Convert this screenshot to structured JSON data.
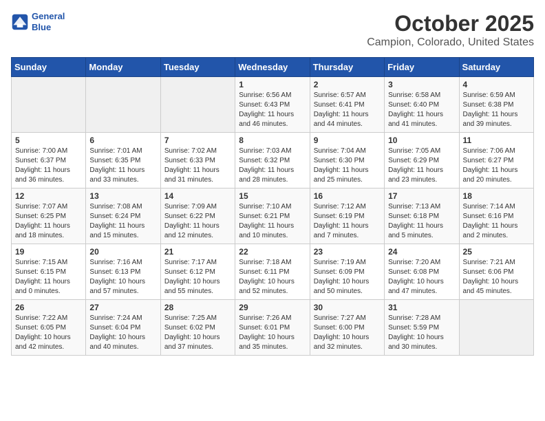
{
  "header": {
    "logo_line1": "General",
    "logo_line2": "Blue",
    "title": "October 2025",
    "subtitle": "Campion, Colorado, United States"
  },
  "days_of_week": [
    "Sunday",
    "Monday",
    "Tuesday",
    "Wednesday",
    "Thursday",
    "Friday",
    "Saturday"
  ],
  "weeks": [
    [
      {
        "day": "",
        "info": ""
      },
      {
        "day": "",
        "info": ""
      },
      {
        "day": "",
        "info": ""
      },
      {
        "day": "1",
        "info": "Sunrise: 6:56 AM\nSunset: 6:43 PM\nDaylight: 11 hours and 46 minutes."
      },
      {
        "day": "2",
        "info": "Sunrise: 6:57 AM\nSunset: 6:41 PM\nDaylight: 11 hours and 44 minutes."
      },
      {
        "day": "3",
        "info": "Sunrise: 6:58 AM\nSunset: 6:40 PM\nDaylight: 11 hours and 41 minutes."
      },
      {
        "day": "4",
        "info": "Sunrise: 6:59 AM\nSunset: 6:38 PM\nDaylight: 11 hours and 39 minutes."
      }
    ],
    [
      {
        "day": "5",
        "info": "Sunrise: 7:00 AM\nSunset: 6:37 PM\nDaylight: 11 hours and 36 minutes."
      },
      {
        "day": "6",
        "info": "Sunrise: 7:01 AM\nSunset: 6:35 PM\nDaylight: 11 hours and 33 minutes."
      },
      {
        "day": "7",
        "info": "Sunrise: 7:02 AM\nSunset: 6:33 PM\nDaylight: 11 hours and 31 minutes."
      },
      {
        "day": "8",
        "info": "Sunrise: 7:03 AM\nSunset: 6:32 PM\nDaylight: 11 hours and 28 minutes."
      },
      {
        "day": "9",
        "info": "Sunrise: 7:04 AM\nSunset: 6:30 PM\nDaylight: 11 hours and 25 minutes."
      },
      {
        "day": "10",
        "info": "Sunrise: 7:05 AM\nSunset: 6:29 PM\nDaylight: 11 hours and 23 minutes."
      },
      {
        "day": "11",
        "info": "Sunrise: 7:06 AM\nSunset: 6:27 PM\nDaylight: 11 hours and 20 minutes."
      }
    ],
    [
      {
        "day": "12",
        "info": "Sunrise: 7:07 AM\nSunset: 6:25 PM\nDaylight: 11 hours and 18 minutes."
      },
      {
        "day": "13",
        "info": "Sunrise: 7:08 AM\nSunset: 6:24 PM\nDaylight: 11 hours and 15 minutes."
      },
      {
        "day": "14",
        "info": "Sunrise: 7:09 AM\nSunset: 6:22 PM\nDaylight: 11 hours and 12 minutes."
      },
      {
        "day": "15",
        "info": "Sunrise: 7:10 AM\nSunset: 6:21 PM\nDaylight: 11 hours and 10 minutes."
      },
      {
        "day": "16",
        "info": "Sunrise: 7:12 AM\nSunset: 6:19 PM\nDaylight: 11 hours and 7 minutes."
      },
      {
        "day": "17",
        "info": "Sunrise: 7:13 AM\nSunset: 6:18 PM\nDaylight: 11 hours and 5 minutes."
      },
      {
        "day": "18",
        "info": "Sunrise: 7:14 AM\nSunset: 6:16 PM\nDaylight: 11 hours and 2 minutes."
      }
    ],
    [
      {
        "day": "19",
        "info": "Sunrise: 7:15 AM\nSunset: 6:15 PM\nDaylight: 11 hours and 0 minutes."
      },
      {
        "day": "20",
        "info": "Sunrise: 7:16 AM\nSunset: 6:13 PM\nDaylight: 10 hours and 57 minutes."
      },
      {
        "day": "21",
        "info": "Sunrise: 7:17 AM\nSunset: 6:12 PM\nDaylight: 10 hours and 55 minutes."
      },
      {
        "day": "22",
        "info": "Sunrise: 7:18 AM\nSunset: 6:11 PM\nDaylight: 10 hours and 52 minutes."
      },
      {
        "day": "23",
        "info": "Sunrise: 7:19 AM\nSunset: 6:09 PM\nDaylight: 10 hours and 50 minutes."
      },
      {
        "day": "24",
        "info": "Sunrise: 7:20 AM\nSunset: 6:08 PM\nDaylight: 10 hours and 47 minutes."
      },
      {
        "day": "25",
        "info": "Sunrise: 7:21 AM\nSunset: 6:06 PM\nDaylight: 10 hours and 45 minutes."
      }
    ],
    [
      {
        "day": "26",
        "info": "Sunrise: 7:22 AM\nSunset: 6:05 PM\nDaylight: 10 hours and 42 minutes."
      },
      {
        "day": "27",
        "info": "Sunrise: 7:24 AM\nSunset: 6:04 PM\nDaylight: 10 hours and 40 minutes."
      },
      {
        "day": "28",
        "info": "Sunrise: 7:25 AM\nSunset: 6:02 PM\nDaylight: 10 hours and 37 minutes."
      },
      {
        "day": "29",
        "info": "Sunrise: 7:26 AM\nSunset: 6:01 PM\nDaylight: 10 hours and 35 minutes."
      },
      {
        "day": "30",
        "info": "Sunrise: 7:27 AM\nSunset: 6:00 PM\nDaylight: 10 hours and 32 minutes."
      },
      {
        "day": "31",
        "info": "Sunrise: 7:28 AM\nSunset: 5:59 PM\nDaylight: 10 hours and 30 minutes."
      },
      {
        "day": "",
        "info": ""
      }
    ]
  ]
}
